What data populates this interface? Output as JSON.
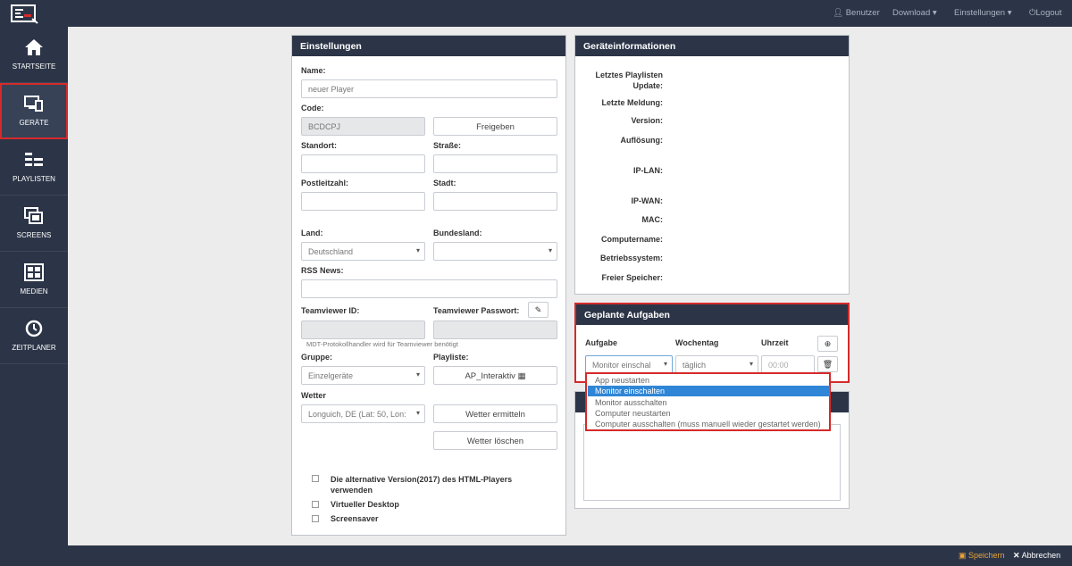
{
  "topbar": {
    "benutzer": "Benutzer",
    "download": "Download",
    "einstellungen": "Einstellungen",
    "logout": "Logout"
  },
  "sidebar": {
    "items": [
      {
        "label": "STARTSEITE",
        "icon": "home-icon"
      },
      {
        "label": "GERÄTE",
        "icon": "devices-icon"
      },
      {
        "label": "PLAYLISTEN",
        "icon": "playlist-icon"
      },
      {
        "label": "SCREENS",
        "icon": "screens-icon"
      },
      {
        "label": "MEDIEN",
        "icon": "media-icon"
      },
      {
        "label": "ZEITPLANER",
        "icon": "clock-icon"
      }
    ]
  },
  "settings": {
    "title": "Einstellungen",
    "name_label": "Name:",
    "name_value": "neuer Player",
    "code_label": "Code:",
    "code_value": "BCDCPJ",
    "release_button": "Freigeben",
    "standort_label": "Standort:",
    "strasse_label": "Straße:",
    "plz_label": "Postleitzahl:",
    "stadt_label": "Stadt:",
    "land_label": "Land:",
    "land_value": "Deutschland",
    "bundesland_label": "Bundesland:",
    "rss_label": "RSS News:",
    "tv_id_label": "Teamviewer ID:",
    "tv_pw_label": "Teamviewer Passwort:",
    "tv_hint": "MDT-Protokollhandler wird für Teamviewer benötigt",
    "gruppe_label": "Gruppe:",
    "gruppe_value": "Einzelgeräte",
    "playlist_label": "Playliste:",
    "playlist_value": "AP_Interaktiv",
    "wetter_label": "Wetter",
    "wetter_value": "Longuich, DE (Lat: 50, Lon:",
    "wetter_find_button": "Wetter ermitteln",
    "wetter_delete_button": "Wetter löschen",
    "checkbox_alt_version": "Die alternative Version(2017) des HTML-Players verwenden",
    "checkbox_virtual": "Virtueller Desktop",
    "checkbox_screensaver": "Screensaver"
  },
  "device_info": {
    "title": "Geräteinformationen",
    "labels": [
      "Letztes Playlisten Update:",
      "Letzte Meldung:",
      "Version:",
      "Auflösung:",
      "IP-LAN:",
      "IP-WAN:",
      "MAC:",
      "Computername:",
      "Betriebssystem:",
      "Freier Speicher:"
    ]
  },
  "tasks": {
    "title": "Geplante Aufgaben",
    "col_aufgabe": "Aufgabe",
    "col_wochentag": "Wochentag",
    "col_uhrzeit": "Uhrzeit",
    "aufgabe_value": "Monitor einschal",
    "wochentag_value": "täglich",
    "uhrzeit_placeholder": "00:00",
    "options": [
      "App neustarten",
      "Monitor einschalten",
      "Monitor ausschalten",
      "Computer neustarten",
      "Computer ausschalten (muss manuell wieder gestartet werden)"
    ],
    "selected_option": "Monitor einschalten"
  },
  "footer": {
    "save": "Speichern",
    "cancel": "Abbrechen"
  },
  "colors": {
    "navy": "#2c3547",
    "highlight_red": "#d52a2a",
    "selection_blue": "#2f86d6",
    "save_orange": "#e8a33a"
  }
}
